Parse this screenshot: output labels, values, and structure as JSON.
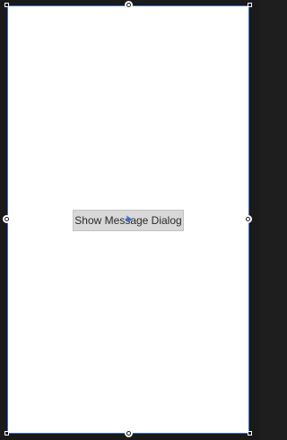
{
  "surface": {
    "button_label": "Show Message Dialog"
  },
  "icons": {
    "grips": [
      "resize-grip-top-icon",
      "resize-grip-bottom-icon",
      "resize-grip-left-icon",
      "resize-grip-right-icon"
    ],
    "cursor": "mouse-cursor-icon"
  },
  "colors": {
    "surface_background": "#ffffff",
    "surface_border": "#3b6fd1",
    "outer_background": "#1a1a1a",
    "button_background": "#d8d8d8",
    "button_text": "#2a2a2a"
  }
}
